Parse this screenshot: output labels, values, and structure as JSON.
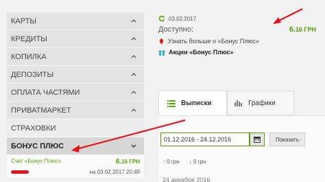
{
  "sidebar": {
    "items": [
      {
        "label": "КАРТЫ"
      },
      {
        "label": "КРЕДИТЫ"
      },
      {
        "label": "КОПИЛКА"
      },
      {
        "label": "ДЕПОЗИТЫ"
      },
      {
        "label": "ОПЛАТА ЧАСТЯМИ"
      },
      {
        "label": "ПРИВАТМАРКЕТ"
      },
      {
        "label": "СТРАХОВКИ"
      },
      {
        "label": "БОНУС ПЛЮС"
      }
    ],
    "sub_account": {
      "name": "Счет «Бонус Плюс»",
      "amount_int": "6.",
      "amount_dec": "16 ГРН",
      "as_of": "на 03.02.2017 20:49"
    }
  },
  "info": {
    "date": "03.02.2017",
    "balance_label": "Доступно:",
    "balance_int": "6.",
    "balance_dec": "16 ГРН",
    "learn_more": "Узнать больше о «Бонус Плюс»",
    "promo": "Акции «Бонус Плюс»"
  },
  "tabs": {
    "statements": "Выписки",
    "charts": "Графики"
  },
  "filter": {
    "date_range": "01.12.2016 - 24.12.2016",
    "show_button": "Показать",
    "income": "0 грн",
    "expense": "0 грн",
    "day_header": "24 декабря 2016"
  },
  "colors": {
    "accent": "#56a00a",
    "alert": "#e3141e"
  }
}
